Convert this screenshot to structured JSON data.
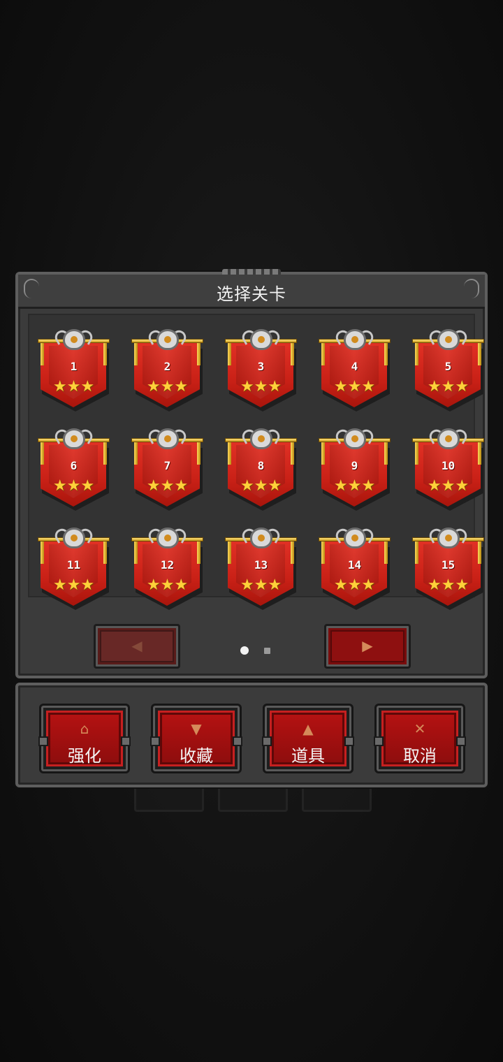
{
  "panel": {
    "title": "选择关卡"
  },
  "levels": [
    {
      "number": "1",
      "stars": "★★★"
    },
    {
      "number": "2",
      "stars": "★★★"
    },
    {
      "number": "3",
      "stars": "★★★"
    },
    {
      "number": "4",
      "stars": "★★★"
    },
    {
      "number": "5",
      "stars": "★★★"
    },
    {
      "number": "6",
      "stars": "★★★"
    },
    {
      "number": "7",
      "stars": "★★★"
    },
    {
      "number": "8",
      "stars": "★★★"
    },
    {
      "number": "9",
      "stars": "★★★"
    },
    {
      "number": "10",
      "stars": "★★★"
    },
    {
      "number": "11",
      "stars": "★★★"
    },
    {
      "number": "12",
      "stars": "★★★"
    },
    {
      "number": "13",
      "stars": "★★★"
    },
    {
      "number": "14",
      "stars": "★★★"
    },
    {
      "number": "15",
      "stars": "★★★"
    }
  ],
  "pagination": {
    "prev_icon": "◀",
    "next_icon": "▶",
    "current_page": 1,
    "total_pages": 2
  },
  "actions": [
    {
      "icon": "upgrade-icon",
      "glyph": "⌂",
      "label": "强化"
    },
    {
      "icon": "goblet-icon",
      "glyph": "▼",
      "label": "收藏"
    },
    {
      "icon": "flask-icon",
      "glyph": "▲",
      "label": "道具"
    },
    {
      "icon": "close-icon",
      "glyph": "✕",
      "label": "取消"
    }
  ],
  "colors": {
    "banner_red": "#c82016",
    "star_gold": "#ffd03a",
    "button_red": "#8d0d0d",
    "panel_gray": "#3b3b3b"
  }
}
